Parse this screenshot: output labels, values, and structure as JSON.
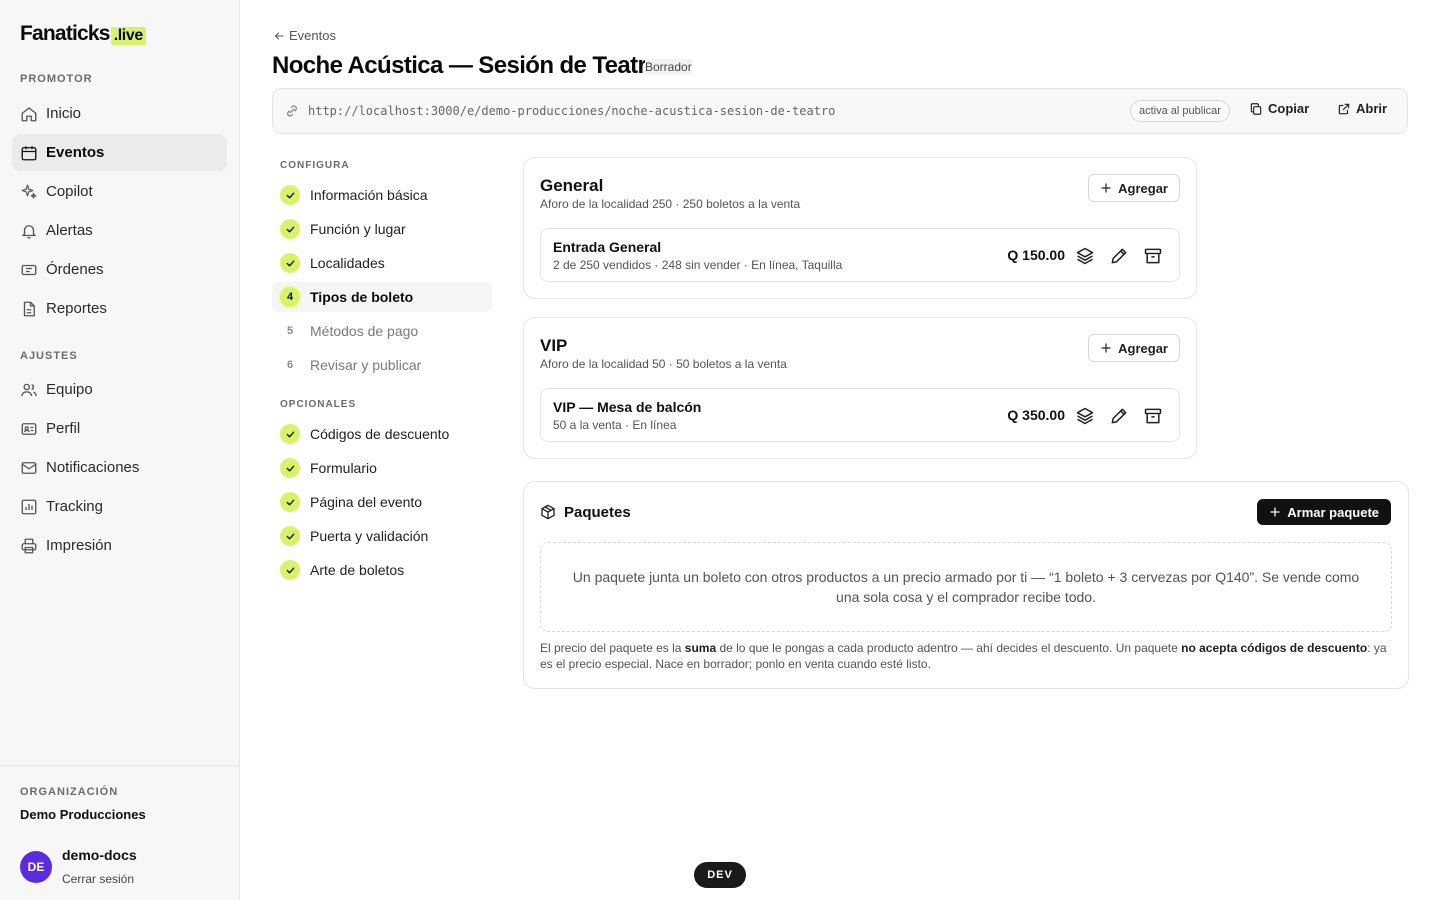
{
  "brand": {
    "name": "Fanaticks",
    "tld": ".live"
  },
  "sidebar": {
    "section_promotor": "PROMOTOR",
    "promotor_items": [
      {
        "label": "Inicio",
        "icon": "home-icon"
      },
      {
        "label": "Eventos",
        "icon": "calendar-icon",
        "active": true
      },
      {
        "label": "Copilot",
        "icon": "sparkle-icon"
      },
      {
        "label": "Alertas",
        "icon": "bell-icon"
      },
      {
        "label": "Órdenes",
        "icon": "ticket-icon"
      },
      {
        "label": "Reportes",
        "icon": "file-icon"
      }
    ],
    "section_ajustes": "AJUSTES",
    "ajustes_items": [
      {
        "label": "Equipo",
        "icon": "users-icon"
      },
      {
        "label": "Perfil",
        "icon": "id-card-icon"
      },
      {
        "label": "Notificaciones",
        "icon": "mail-icon"
      },
      {
        "label": "Tracking",
        "icon": "chart-icon"
      },
      {
        "label": "Impresión",
        "icon": "printer-icon"
      }
    ],
    "org_label": "ORGANIZACIÓN",
    "org_name": "Demo Producciones",
    "user_initials": "DE",
    "user_name": "demo-docs",
    "logout": "Cerrar sesión"
  },
  "header": {
    "back": "Eventos",
    "title": "Noche Acústica — Sesión de Teatro",
    "status": "Borrador"
  },
  "url_bar": {
    "url": "http://localhost:3000/e/demo-producciones/noche-acustica-sesion-de-teatro",
    "pill": "activa al publicar",
    "copy": "Copiar",
    "open": "Abrir"
  },
  "steps": {
    "configura_heading": "CONFIGURA",
    "configura": [
      {
        "label": "Información básica",
        "state": "done"
      },
      {
        "label": "Función y lugar",
        "state": "done"
      },
      {
        "label": "Localidades",
        "state": "done"
      },
      {
        "label": "Tipos de boleto",
        "state": "current",
        "num": "4"
      },
      {
        "label": "Métodos de pago",
        "state": "pending",
        "num": "5"
      },
      {
        "label": "Revisar y publicar",
        "state": "pending",
        "num": "6"
      }
    ],
    "opcionales_heading": "OPCIONALES",
    "opcionales": [
      {
        "label": "Códigos de descuento",
        "state": "done"
      },
      {
        "label": "Formulario",
        "state": "done"
      },
      {
        "label": "Página del evento",
        "state": "done"
      },
      {
        "label": "Puerta y validación",
        "state": "done"
      },
      {
        "label": "Arte de boletos",
        "state": "done"
      }
    ]
  },
  "localities": [
    {
      "name": "General",
      "subtitle": "Aforo de la localidad 250 · 250 boletos a la venta",
      "add_label": "Agregar",
      "ticket": {
        "name": "Entrada General",
        "meta": "2 de 250 vendidos · 248 sin vender · En línea, Taquilla",
        "price": "Q 150.00"
      }
    },
    {
      "name": "VIP",
      "subtitle": "Aforo de la localidad 50 · 50 boletos a la venta",
      "add_label": "Agregar",
      "ticket": {
        "name": "VIP — Mesa de balcón",
        "meta": "50 a la venta · En línea",
        "price": "Q 350.00"
      }
    }
  ],
  "packages": {
    "title": "Paquetes",
    "button": "Armar paquete",
    "empty": "Un paquete junta un boleto con otros productos a un precio armado por ti — “1 boleto + 3 cervezas por Q140”. Se vende como una sola cosa y el comprador recibe todo.",
    "note_1": "El precio del paquete es la ",
    "note_bold_1": "suma",
    "note_2": " de lo que le pongas a cada producto adentro — ahí decides el descuento. Un paquete ",
    "note_bold_2": "no acepta códigos de descuento",
    "note_3": ": ya es el precio especial. Nace en borrador; ponlo en venta cuando esté listo."
  },
  "dev_badge": "DEV",
  "colors": {
    "accent": "#d8f36a",
    "avatar": "#5b2be0",
    "dark": "#111111"
  }
}
